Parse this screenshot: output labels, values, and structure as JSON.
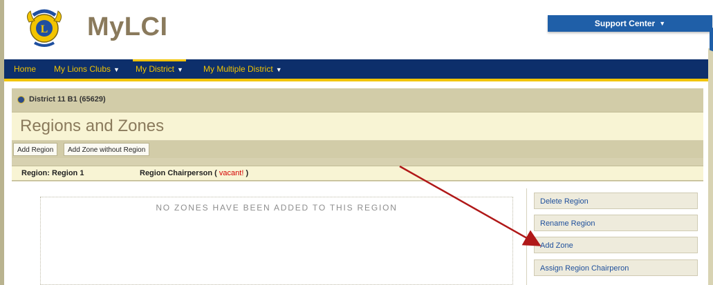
{
  "header": {
    "brand": "MyLCI",
    "support_label": "Support Center"
  },
  "nav": {
    "items": [
      {
        "label": "Home"
      },
      {
        "label": "My Lions Clubs"
      },
      {
        "label": "My District"
      },
      {
        "label": "My Multiple District"
      }
    ]
  },
  "district": {
    "label": "District 11 B1 (65629)"
  },
  "page": {
    "title": "Regions and Zones"
  },
  "toolbar": {
    "add_region": "Add Region",
    "add_zone_without_region": "Add Zone without Region"
  },
  "region": {
    "label": "Region: Region 1",
    "chair_label": "Region Chairperson (",
    "chair_value": "vacant!",
    "chair_close": ")",
    "empty_message": "NO ZONES HAVE BEEN ADDED TO THIS REGION",
    "actions": [
      {
        "label": "Delete Region"
      },
      {
        "label": "Rename Region"
      },
      {
        "label": "Add Zone"
      },
      {
        "label": "Assign Region Chairperon"
      }
    ]
  },
  "colors": {
    "nav_bg": "#0d2f6b",
    "nav_accent": "#f2c400",
    "support_bg": "#1f5fa8",
    "panel_bg": "#d7d1b0",
    "title_band": "#f8f4d4",
    "brand_text": "#8a7a5c",
    "vacant_text": "#d40000",
    "link_text": "#1e4f9b",
    "arrow": "#b01818"
  }
}
